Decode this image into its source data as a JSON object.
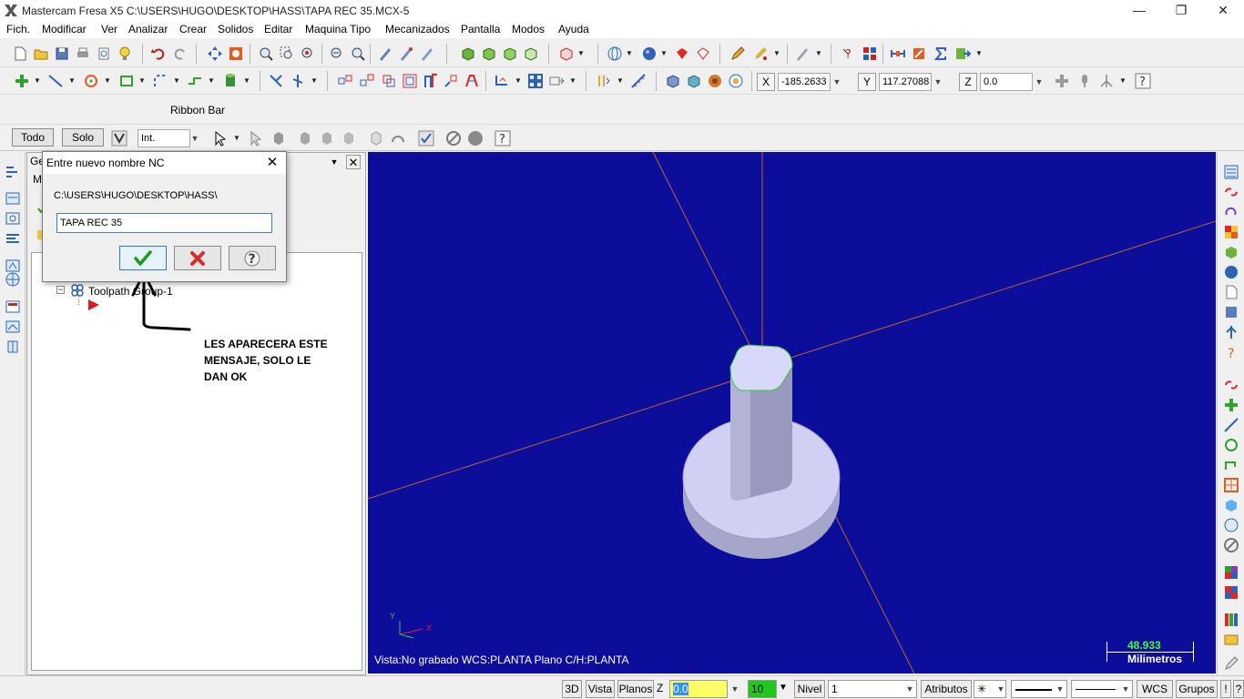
{
  "titlebar": {
    "title": "Mastercam Fresa X5  C:\\USERS\\HUGO\\DESKTOP\\HASS\\TAPA REC 35.MCX-5",
    "minimize": "—",
    "maximize": "❐",
    "close": "✕"
  },
  "menu": {
    "items": [
      "Fich.",
      "Modificar",
      "Ver",
      "Analizar",
      "Crear",
      "Solidos",
      "Editar",
      "Maquina Tipo",
      "Mecanizados",
      "Pantalla",
      "Modos",
      "Ayuda"
    ]
  },
  "coords": {
    "x_label": "X",
    "x_value": "-185.2633",
    "y_label": "Y",
    "y_value": "117.27088",
    "z_label": "Z",
    "z_value": "0.0"
  },
  "ribbon": {
    "label": "Ribbon Bar"
  },
  "selection_bar": {
    "all_button": "Todo",
    "only_button": "Solo",
    "mode_value": "Int."
  },
  "manager": {
    "tab_partial": "Ge",
    "tab2_partial": "M",
    "tree_item": "Toolpath Group-1"
  },
  "dialog": {
    "title": "Entre nuevo nombre NC",
    "close": "✕",
    "path": "C:\\USERS\\HUGO\\DESKTOP\\HASS\\",
    "name_value": "TAPA REC 35",
    "ok_icon": "✔",
    "cancel_icon": "✖",
    "help_icon": "?"
  },
  "annotation": {
    "text": "LES APARECERA ESTE\nMENSAJE, SOLO LE\nDAN OK"
  },
  "viewport": {
    "status": "Vista:No grabado   WCS:PLANTA   Plano C/H:PLANTA",
    "scale_value": "48.933",
    "scale_unit": "Milimetros",
    "axis_y": "Y",
    "axis_x": "X",
    "bg_color": "#0d0d9c"
  },
  "statusbar": {
    "btn_3d": "3D",
    "btn_vista": "Vista",
    "btn_planos": "Planos",
    "z_label": "Z",
    "z_value": "0.0",
    "level_value": "10",
    "nivel_label": "Nivel",
    "nivel_value": "1",
    "atributos": "Atributos",
    "wcs": "WCS",
    "grupos": "Grupos",
    "excl": "!",
    "q": "?"
  },
  "colors": {
    "accent": "#2f7ad3",
    "ok_green": "#1a9c1a",
    "cancel_red": "#d92c2c"
  }
}
